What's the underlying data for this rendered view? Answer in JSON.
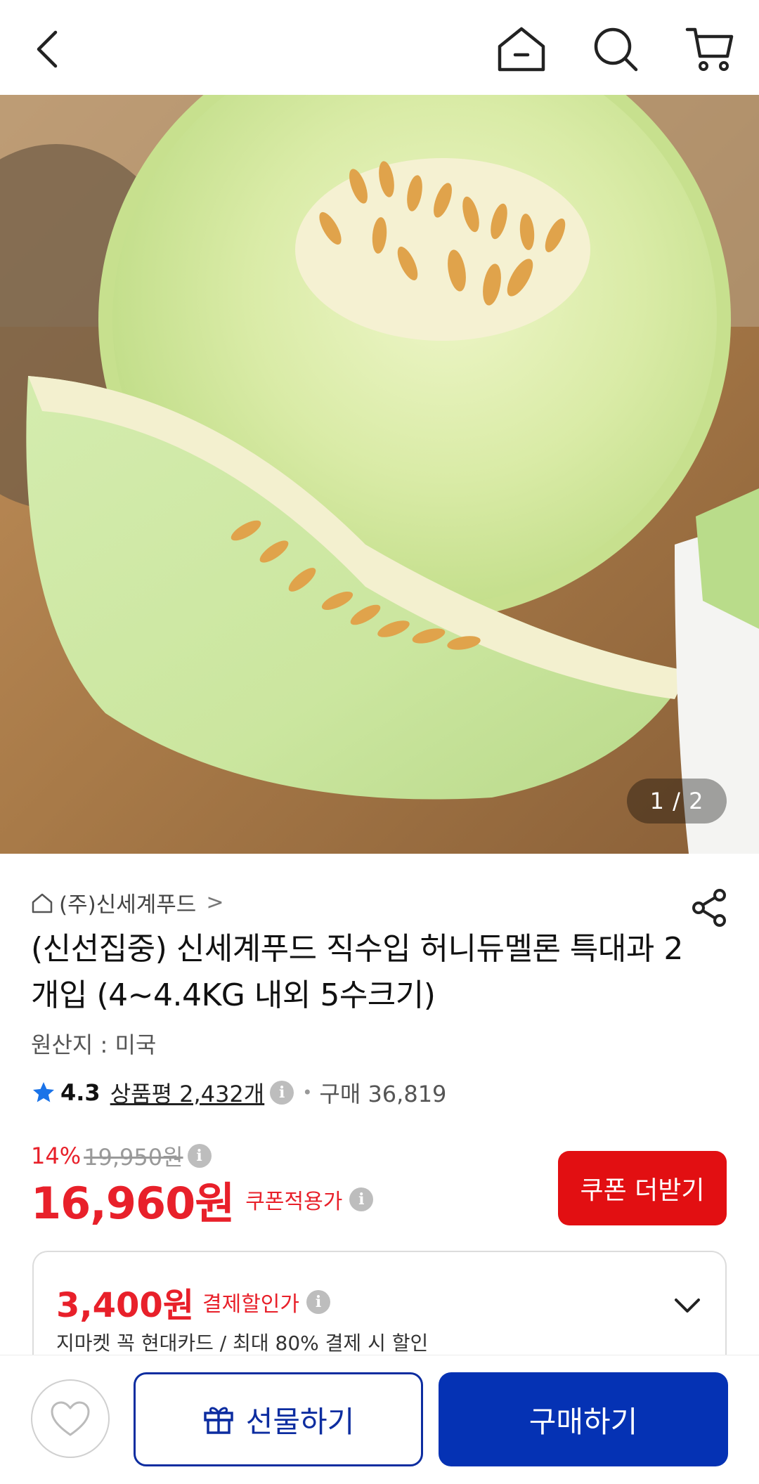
{
  "topbar": {
    "icons": [
      "back-arrow-icon",
      "home-icon",
      "search-icon",
      "cart-icon"
    ]
  },
  "gallery": {
    "counter": "1 / 2",
    "image_subject": "honeydew-melon-photo"
  },
  "product": {
    "seller": "(주)신세계푸드",
    "seller_chevron": ">",
    "title": "(신선집중) 신세계푸드 직수입 허니듀멜론 특대과 2개입 (4~4.4KG 내외 5수크기)",
    "origin": "원산지 : 미국",
    "rating": "4.3",
    "reviews": "상품평 2,432개",
    "sales": "구매 36,819"
  },
  "price": {
    "discount_pct": "14%",
    "original": "19,950원",
    "final": "16,960원",
    "final_label": "쿠폰적용가",
    "coupon_button": "쿠폰 더받기"
  },
  "card_discount": {
    "price": "3,400원",
    "label": "결제할인가",
    "description": "지마켓 꼭 현대카드 / 최대 80% 결제 시 할인"
  },
  "bottom": {
    "gift_label": "선물하기",
    "buy_label": "구매하기"
  },
  "colors": {
    "accent_red": "#e8202a",
    "coupon_red": "#e20f12",
    "brand_blue": "#0532b4",
    "info_icon_gray": "#bdbdbd"
  },
  "info_glyph": "i"
}
